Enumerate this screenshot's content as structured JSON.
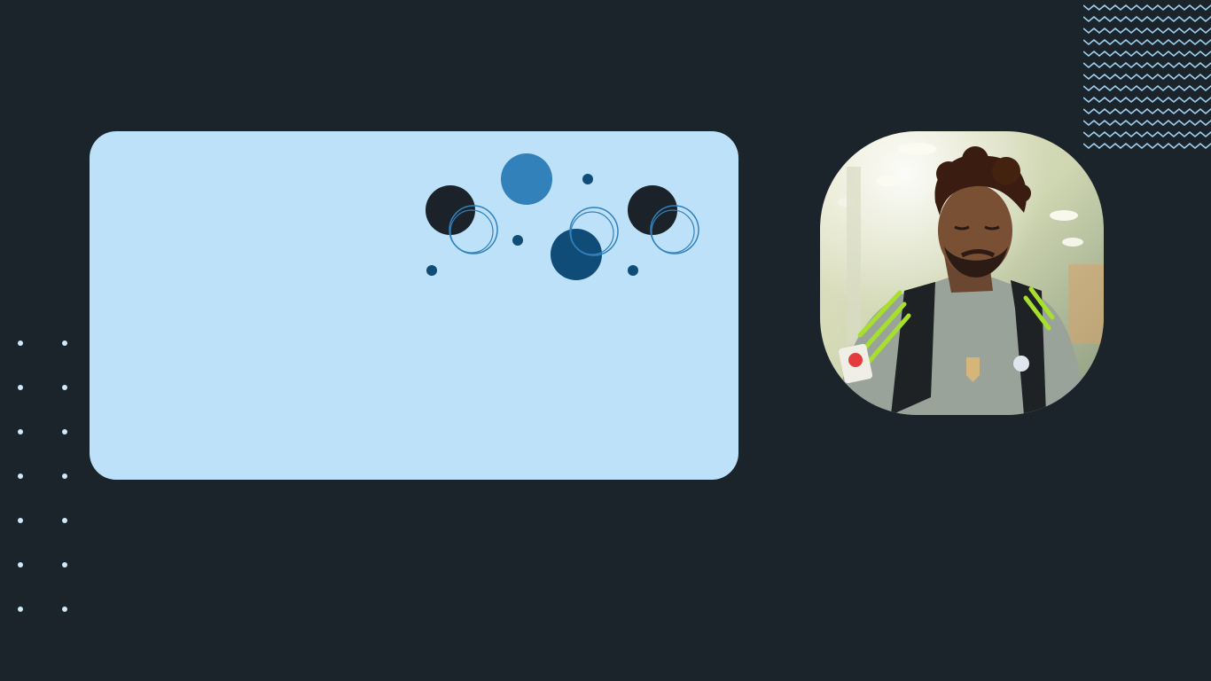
{
  "slide": {
    "background_color": "#1c242b",
    "card_color": "#bde1f8"
  },
  "decor": {
    "zigzag_icon": "zigzag-lines-icon",
    "dot_grid_icon": "dot-grid-icon",
    "bubbles_icon": "bubbles-cluster-icon",
    "accent_colors": [
      "#1b2229",
      "#3281bb",
      "#0f4c78"
    ]
  },
  "profile": {
    "photo_icon": "person-photo-icon"
  }
}
